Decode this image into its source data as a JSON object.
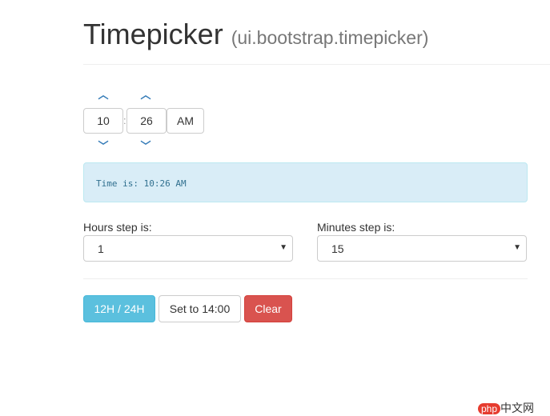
{
  "header": {
    "title": "Timepicker",
    "subtitle": "(ui.bootstrap.timepicker)"
  },
  "timepicker": {
    "hours": "10",
    "minutes": "26",
    "separator": ":",
    "meridian": "AM"
  },
  "alert": {
    "text": "Time is: 10:26 AM"
  },
  "hours_step": {
    "label": "Hours step is:",
    "value": "1"
  },
  "minutes_step": {
    "label": "Minutes step is:",
    "value": "15"
  },
  "buttons": {
    "toggle": "12H / 24H",
    "set": "Set to 14:00",
    "clear": "Clear"
  },
  "watermark": {
    "text": "php中文网"
  }
}
